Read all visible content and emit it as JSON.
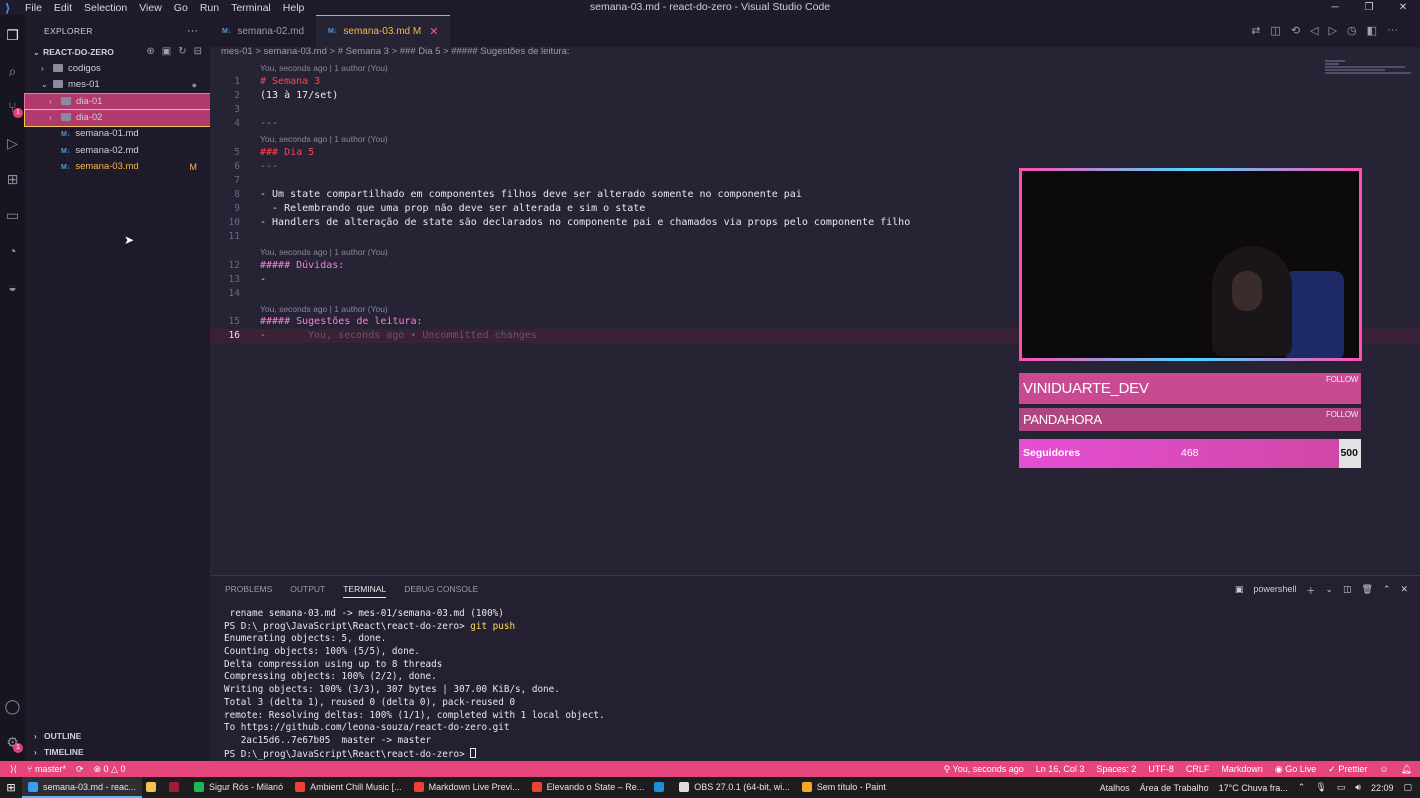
{
  "window": {
    "title": "semana-03.md - react-do-zero - Visual Studio Code",
    "menu": [
      "File",
      "Edit",
      "Selection",
      "View",
      "Go",
      "Run",
      "Terminal",
      "Help"
    ]
  },
  "activity": {
    "scm_badge": "1",
    "settings_badge": "1"
  },
  "sidebar": {
    "header": "EXPLORER",
    "root": "REACT-DO-ZERO",
    "tree": [
      {
        "label": "codigos"
      },
      {
        "label": "mes-01"
      },
      {
        "label": "dia-01"
      },
      {
        "label": "dia-02"
      },
      {
        "label": "semana-01.md"
      },
      {
        "label": "semana-02.md"
      },
      {
        "label": "semana-03.md",
        "status": "M"
      }
    ],
    "outline": "OUTLINE",
    "timeline": "TIMELINE"
  },
  "tabs": [
    {
      "label": "semana-02.md"
    },
    {
      "label": "semana-03.md",
      "status": "M"
    }
  ],
  "breadcrumb": "mes-01 > semana-03.md > # Semana 3 > ### Dia 5 > ##### Sugestões de leitura:",
  "editor": {
    "lens_text": "You, seconds ago | 1 author (You)",
    "lines": [
      {
        "n": "1",
        "text": "# Semana 3"
      },
      {
        "n": "2",
        "text": "(13 à 17/set)"
      },
      {
        "n": "3",
        "text": ""
      },
      {
        "n": "4",
        "text": "---"
      },
      {
        "n": "5",
        "text": "### Dia 5"
      },
      {
        "n": "6",
        "text": "---"
      },
      {
        "n": "7",
        "text": ""
      },
      {
        "n": "8",
        "text": "- Um state compartilhado em componentes filhos deve ser alterado somente no componente pai"
      },
      {
        "n": "9",
        "text": "  - Relembrando que uma prop não deve ser alterada e sim o state"
      },
      {
        "n": "10",
        "text": "- Handlers de alteração de state são declarados no componente pai e chamados via props pelo componente filho"
      },
      {
        "n": "11",
        "text": ""
      },
      {
        "n": "12",
        "text": "##### Dúvidas:"
      },
      {
        "n": "13",
        "text": "-"
      },
      {
        "n": "14",
        "text": ""
      },
      {
        "n": "15",
        "text": "##### Sugestões de leitura:"
      },
      {
        "n": "16",
        "text": "-"
      }
    ],
    "ghost": "You, seconds ago • Uncommitted changes"
  },
  "overlay": {
    "name1": "VINIDUARTE_DEV",
    "name2": "PANDAHORA",
    "follow": "FOLLOW",
    "progress_label": "Seguidores",
    "progress_value": "468",
    "progress_target": "500",
    "progress_fraction": 0.936
  },
  "panel": {
    "tabs": [
      "PROBLEMS",
      "OUTPUT",
      "TERMINAL",
      "DEBUG CONSOLE"
    ],
    "shell": "powershell",
    "terminal": [
      " rename semana-03.md -> mes-01/semana-03.md (100%)",
      "PS D:\\_prog\\JavaScript\\React\\react-do-zero> ",
      "Enumerating objects: 5, done.",
      "Counting objects: 100% (5/5), done.",
      "Delta compression using up to 8 threads",
      "Compressing objects: 100% (2/2), done.",
      "Writing objects: 100% (3/3), 307 bytes | 307.00 KiB/s, done.",
      "Total 3 (delta 1), reused 0 (delta 0), pack-reused 0",
      "remote: Resolving deltas: 100% (1/1), completed with 1 local object.",
      "To https://github.com/leona-souza/react-do-zero.git",
      "   2ac15d6..7e67b05  master -> master",
      "PS D:\\_prog\\JavaScript\\React\\react-do-zero> "
    ],
    "terminal_cmd": "git push"
  },
  "statusbar": {
    "branch": "master*",
    "problems": "0 △ 0",
    "blame": "You, seconds ago",
    "position": "Ln 16, Col 3",
    "spaces": "Spaces: 2",
    "encoding": "UTF-8",
    "eol": "CRLF",
    "language": "Markdown",
    "golive": "Go Live",
    "prettier": "Prettier"
  },
  "taskbar": {
    "apps": [
      {
        "label": "semana-03.md - reac...",
        "color": "#3b9ded"
      },
      {
        "label": "",
        "color": "#f3c34c"
      },
      {
        "label": "",
        "color": "#a11b3a"
      },
      {
        "label": "Sigur Rós - Milanó",
        "color": "#1db954"
      },
      {
        "label": "Ambient Chill Music [...",
        "color": "#ea4335"
      },
      {
        "label": "Markdown Live Previ...",
        "color": "#ea4335"
      },
      {
        "label": "Elevando o State – Re...",
        "color": "#ea4335"
      },
      {
        "label": "",
        "color": "#1d8fd8"
      },
      {
        "label": "OBS 27.0.1 (64-bit, wi...",
        "color": "#dddddd"
      },
      {
        "label": "Sem título - Paint",
        "color": "#f5a623"
      }
    ],
    "shortcuts": "Atalhos",
    "desktop": "Área de Trabalho",
    "weather": "17°C  Chuva fra...",
    "clock": "22:09"
  }
}
